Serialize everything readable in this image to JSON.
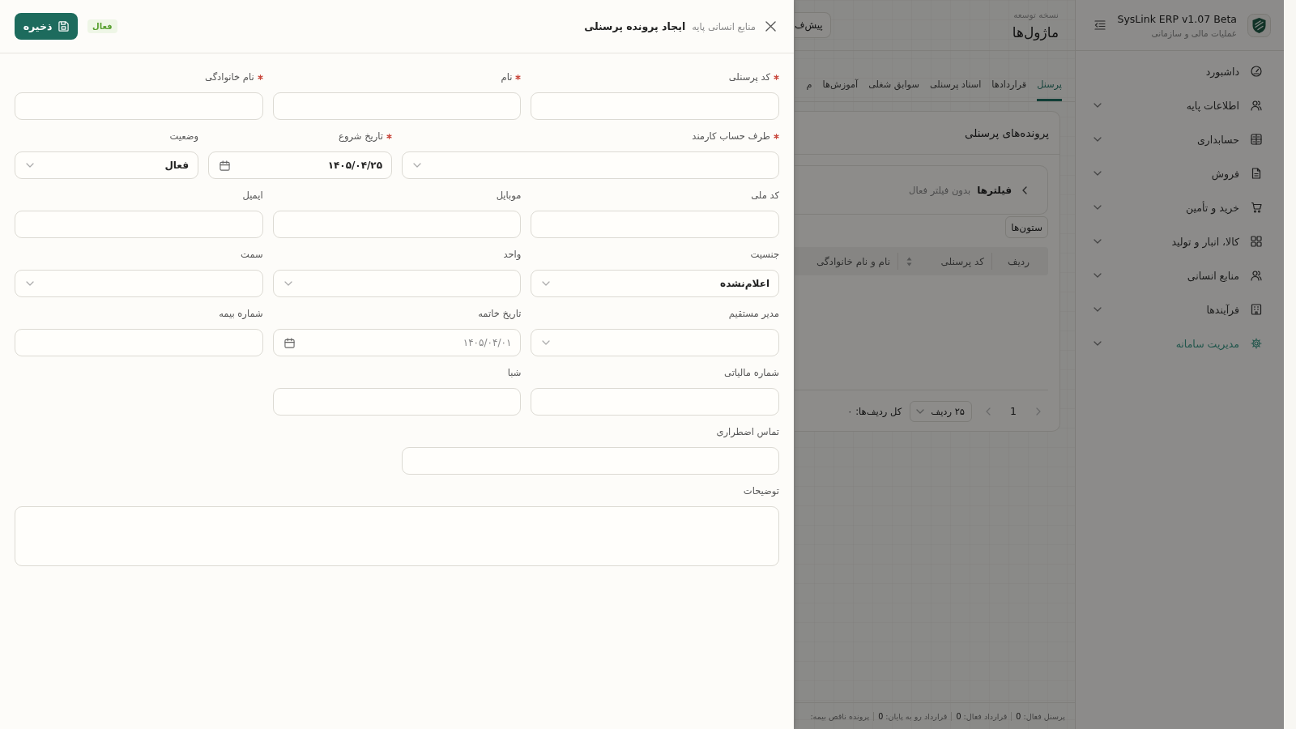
{
  "sidebar": {
    "app_title": "SysLink ERP v1.07 Beta",
    "app_subtitle": "عملیات مالی و سازمانی",
    "items": [
      {
        "label": "داشبورد",
        "kind": "link",
        "selected": false
      },
      {
        "label": "اطلاعات پایه",
        "kind": "group",
        "selected": false
      },
      {
        "label": "حسابداری",
        "kind": "group",
        "selected": false
      },
      {
        "label": "فروش",
        "kind": "group",
        "selected": false
      },
      {
        "label": "خرید و تأمین",
        "kind": "group",
        "selected": false
      },
      {
        "label": "کالا، انبار و تولید",
        "kind": "group",
        "selected": false
      },
      {
        "label": "منابع انسانی",
        "kind": "group",
        "selected": false
      },
      {
        "label": "فرآیندها",
        "kind": "group",
        "selected": false
      },
      {
        "label": "مدیریت سامانه",
        "kind": "group",
        "selected": true
      }
    ]
  },
  "main": {
    "header": {
      "subtitle": "نسخه توسعه",
      "title": "ماژول‌ها",
      "button": "پیش‌ف"
    },
    "tabs": [
      {
        "label": "پرسنل",
        "selected": true
      },
      {
        "label": "قراردادها",
        "selected": false
      },
      {
        "label": "اسناد پرسنلی",
        "selected": false
      },
      {
        "label": "سوابق شغلی",
        "selected": false
      },
      {
        "label": "آموزش‌ها",
        "selected": false
      },
      {
        "label": "م",
        "selected": false
      }
    ],
    "card": {
      "title": "پرونده‌های پرسنلی",
      "filters": {
        "title": "فیلترها",
        "summary": "بدون فیلتر فعال"
      },
      "columns_button": "ستون‌ها",
      "table": {
        "columns": [
          {
            "label": "ردیف",
            "sortable": false
          },
          {
            "label": "کد پرسنلی",
            "sortable": true
          },
          {
            "label": "نام و نام خانوادگی",
            "sortable": false
          }
        ]
      },
      "pagination": {
        "previous_disabled": true,
        "page": "1",
        "next_disabled": true,
        "page_size": "۲۵ ردیف",
        "total": "کل ردیف‌ها: ۰"
      }
    },
    "status_bar": [
      {
        "label": "پرسنل فعال:",
        "value": "0"
      },
      {
        "label": "قرارداد فعال:",
        "value": "0"
      },
      {
        "label": "قرارداد رو به پایان:",
        "value": "0"
      },
      {
        "label": "پرونده ناقص بیمه:"
      }
    ]
  },
  "drawer": {
    "breadcrumb": "منابع انسانی پایه",
    "title": "ایجاد پرونده پرسنلی",
    "status_badge": "فعال",
    "save_button": "ذخیره",
    "fields": [
      {
        "label": "کد پرسنلی",
        "required": true,
        "kind": "text"
      },
      {
        "label": "نام",
        "required": true,
        "kind": "text"
      },
      {
        "label": "نام خانوادگی",
        "required": true,
        "kind": "text"
      },
      {
        "label": "طرف حساب کارمند",
        "required": true,
        "kind": "select"
      },
      {
        "label": "تاریخ شروع",
        "required": true,
        "kind": "date",
        "value": "۱۴۰۵/۰۴/۲۵"
      },
      {
        "label": "وضعیت",
        "required": false,
        "kind": "select",
        "value": "فعال"
      },
      {
        "label": "کد ملی",
        "required": false,
        "kind": "text"
      },
      {
        "label": "موبایل",
        "required": false,
        "kind": "text"
      },
      {
        "label": "ایمیل",
        "required": false,
        "kind": "text"
      },
      {
        "label": "جنسیت",
        "required": false,
        "kind": "select",
        "value": "اعلام‌نشده"
      },
      {
        "label": "واحد",
        "required": false,
        "kind": "select"
      },
      {
        "label": "سمت",
        "required": false,
        "kind": "select"
      },
      {
        "label": "مدیر مستقیم",
        "required": false,
        "kind": "select"
      },
      {
        "label": "تاریخ خاتمه",
        "required": false,
        "kind": "date",
        "placeholder": "۱۴۰۵/۰۴/۰۱"
      },
      {
        "label": "شماره بیمه",
        "required": false,
        "kind": "text"
      },
      {
        "label": "شماره مالیاتی",
        "required": false,
        "kind": "text"
      },
      {
        "label": "شبا",
        "required": false,
        "kind": "text"
      },
      {
        "label": "تماس اضطراری",
        "required": false,
        "kind": "text"
      },
      {
        "label": "توضیحات",
        "required": false,
        "kind": "textarea"
      }
    ]
  }
}
